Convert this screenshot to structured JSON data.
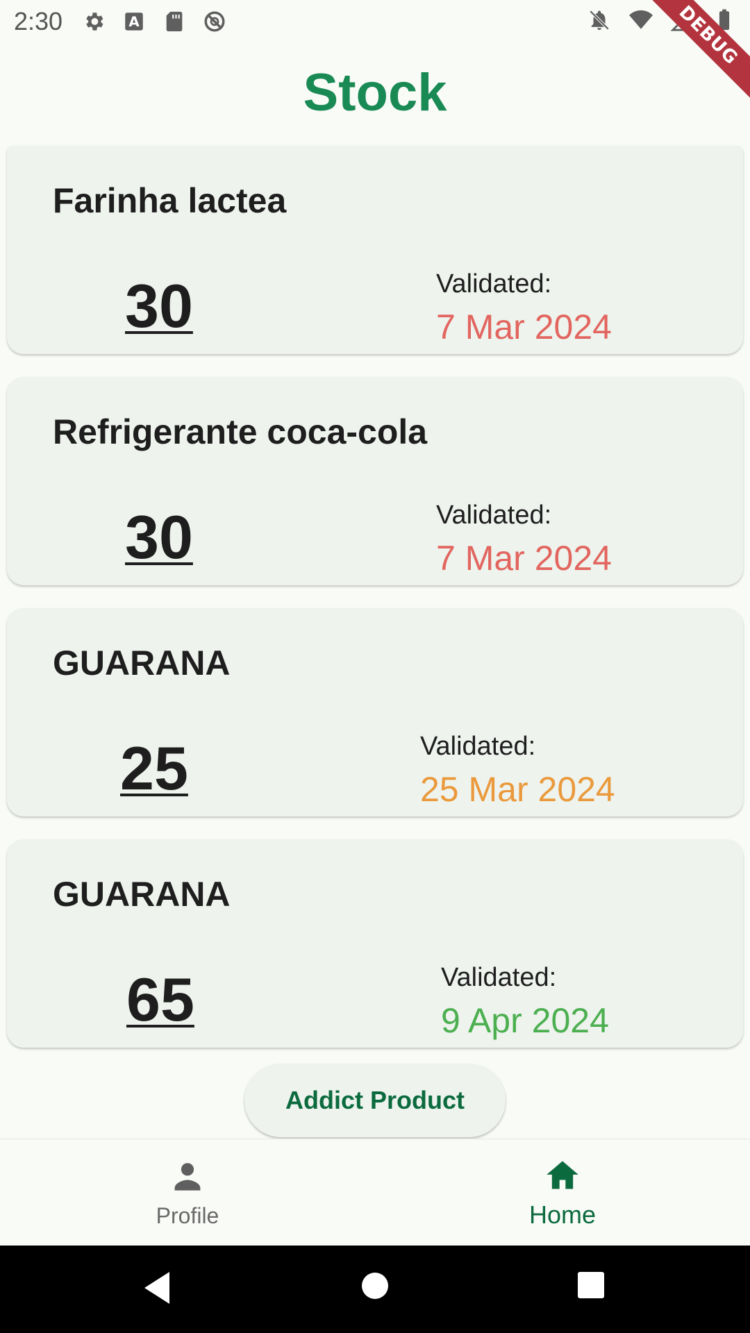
{
  "status_bar": {
    "time": "2:30",
    "icons_left": [
      "settings-icon",
      "font-a-icon",
      "sd-card-icon",
      "do-not-disturb-icon"
    ],
    "icons_right": [
      "notifications-off-icon",
      "wifi-icon",
      "signal-icon",
      "battery-icon"
    ]
  },
  "debug_banner": "DEBUG",
  "page": {
    "title": "Stock"
  },
  "products": [
    {
      "name": "Farinha lactea",
      "quantity": "30",
      "validated_label": "Validated:",
      "date": "7 Mar 2024",
      "date_color": "#e2665f"
    },
    {
      "name": "Refrigerante coca-cola",
      "quantity": "30",
      "validated_label": "Validated:",
      "date": "7 Mar 2024",
      "date_color": "#e2665f"
    },
    {
      "name": "GUARANA",
      "quantity": "25",
      "validated_label": "Validated:",
      "date": "25 Mar 2024",
      "date_color": "#ea9a3c"
    },
    {
      "name": "GUARANA",
      "quantity": "65",
      "validated_label": "Validated:",
      "date": "9 Apr 2024",
      "date_color": "#4caf50"
    }
  ],
  "add_button": {
    "label": "Addict Product"
  },
  "bottom_nav": {
    "items": [
      {
        "label": "Profile",
        "icon": "person-icon",
        "active": false
      },
      {
        "label": "Home",
        "icon": "home-icon",
        "active": true
      }
    ]
  },
  "colors": {
    "accent": "#1a8a55",
    "active_nav": "#0c6b3e",
    "card_bg": "#eef3ee"
  }
}
